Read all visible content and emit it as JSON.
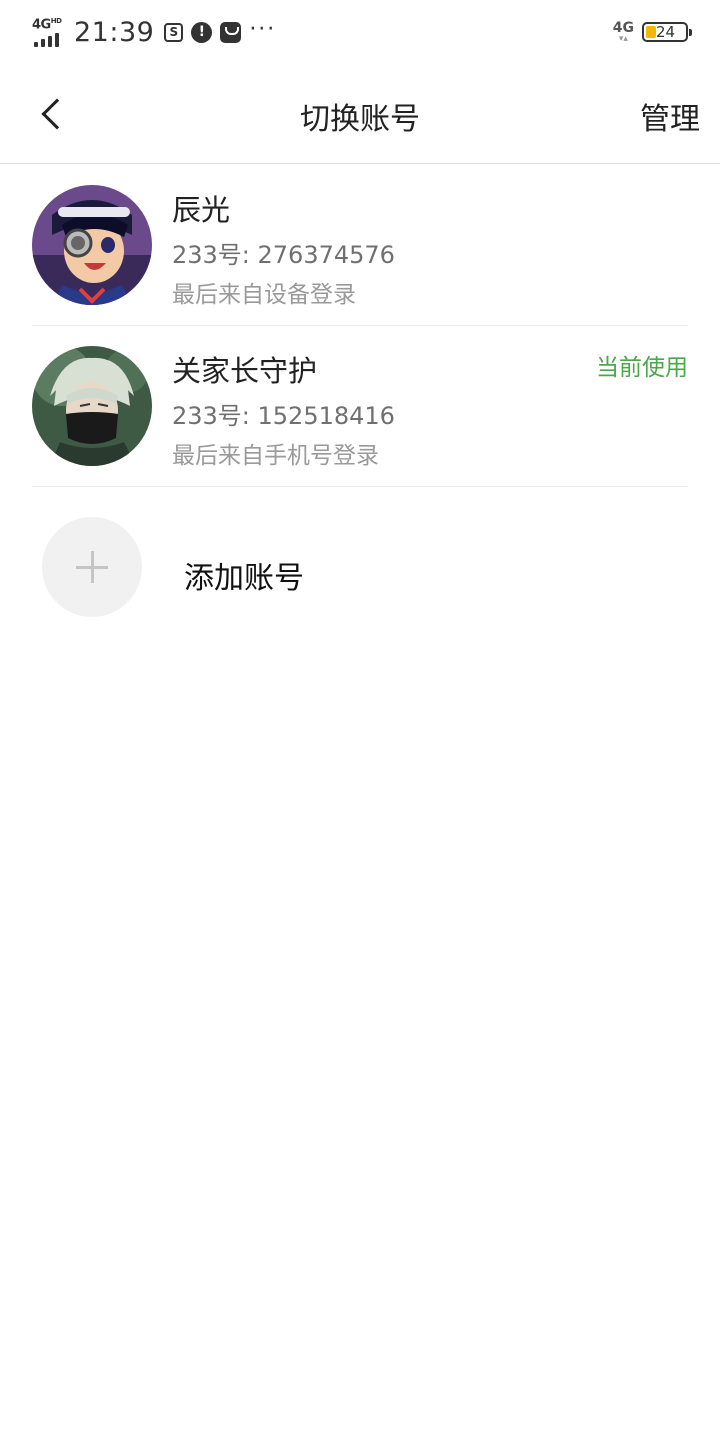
{
  "status_bar": {
    "network": "4G",
    "network_hd": "HD",
    "time": "21:39",
    "right_network": "4G",
    "battery": "24",
    "icons": [
      "screenshot-icon",
      "alert-icon",
      "shopping-icon",
      "more-dots-icon"
    ]
  },
  "header": {
    "title": "切换账号",
    "manage_label": "管理",
    "back_icon": "chevron-left-icon"
  },
  "accounts": [
    {
      "name": "辰光",
      "id_text": "233号: 276374576",
      "login_text": "最后来自设备登录",
      "badge": ""
    },
    {
      "name": "关家长守护",
      "id_text": "233号: 152518416",
      "login_text": "最后来自手机号登录",
      "badge": "当前使用"
    }
  ],
  "add_account": {
    "label": "添加账号",
    "icon": "plus-icon"
  },
  "colors": {
    "accent_green": "#4aa84a",
    "divider": "#ececec",
    "battery_fill": "#f5b800"
  }
}
